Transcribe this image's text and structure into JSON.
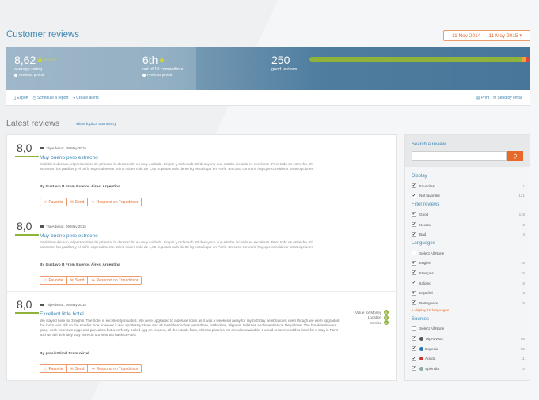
{
  "page_title": "Customer reviews",
  "date_range": "11 Nov 2014 — 11 May 2015",
  "stats": {
    "rating": {
      "value": "8,62",
      "delta": "+ 1.5%",
      "label": "average rating",
      "sub": "Previous period"
    },
    "rank": {
      "value": "6th",
      "label": "out of 10 competitors",
      "sub": "Previous period"
    },
    "good": {
      "value": "250",
      "label": "good reviews"
    }
  },
  "colors": {
    "accent": "#3f87b3",
    "orange": "#e86a2b",
    "green": "#8fb23a",
    "stats_bg": "#47769a"
  },
  "toolbar": {
    "export": "Export",
    "schedule": "Schedule a report",
    "alerts": "Create alerts",
    "print": "Print",
    "email": "Send by email"
  },
  "latest": {
    "title": "Latest reviews",
    "view_topics": "view topics summary"
  },
  "actions": {
    "favorite": "Favorite",
    "send": "Send",
    "respond": "Respond on Tripadvisor"
  },
  "reviews": [
    {
      "score": "8,0",
      "meta": "TripAdvisor, 09 May 2015",
      "title": "Muy bueno pero estrecho",
      "text": "Está bien ubicado, el personal es de primera, la decoración es muy cuidada. Limpio y ordenado. El desayuno que estaba incluido es excelente. Pero todo es estrecho. El ascensor, los pasillos y el baño especialmente. Si no mides más de 1,80 m pesas más de 80 kg es tu lugar en París. En caso contrario hay que considerar otras opciones",
      "author": "By Gustavo B From Buenos Aires, Argentina"
    },
    {
      "score": "8,0",
      "meta": "TripAdvisor, 09 May 2015",
      "title": "Muy bueno pero estrecho",
      "text": "Está bien ubicado, el personal es de primera, la decoración es muy cuidada. Limpio y ordenado. El desayuno que estaba incluido es excelente. Pero todo es estrecho. El ascensor, los pasillos y el baño especialmente. Si no mides más de 1,80 m pesas más de 80 kg es tu lugar en París. En caso contrario hay que considerar otras opciones",
      "author": "By Gustavo B From Buenos Aires, Argentina"
    },
    {
      "score": "8,0",
      "meta": "TripAdvisor, 06 May 2015",
      "title": "Excellent little hotel",
      "text": "We stayed here for 3 nights. The hotel is excellently situated. We were upgraded to a deluxe room as it was a weekend away for my birthday celebrations, even though we were upgraded the room was still on the smaller side however it was spotlessly clean and all the little touches were there, bathrobes, slippers, toiletries and sweeties on the pillows! The breakfasts were good, cook your own eggs and pancakes but a perfectly boiled egg on request, all the usuals from, cheese pastries etc are also available. I would recommend this hotel for a stay in Paris and we will definitely stay here on our next trip back to Paris",
      "author": "By gracieWirral From wirral",
      "subscores": [
        {
          "label": "Value for Money",
          "value": "5"
        },
        {
          "label": "Location",
          "value": "5"
        },
        {
          "label": "Service",
          "value": "5"
        }
      ]
    }
  ],
  "sidebar": {
    "search_label": "Search a review",
    "display": {
      "title": "Display",
      "items": [
        {
          "label": "Favorites",
          "count": "1",
          "checked": true
        },
        {
          "label": "Not favorites",
          "count": "121",
          "checked": true
        }
      ]
    },
    "filter": {
      "title": "Filter reviews",
      "items": [
        {
          "label": "Good",
          "count": "118",
          "checked": true
        },
        {
          "label": "Neutral",
          "count": "0",
          "checked": true
        },
        {
          "label": "Bad",
          "count": "4",
          "checked": true
        }
      ]
    },
    "languages": {
      "title": "Languages",
      "items": [
        {
          "label": "Select All/None",
          "count": "",
          "checked": false
        },
        {
          "label": "English",
          "count": "79",
          "checked": true
        },
        {
          "label": "Français",
          "count": "16",
          "checked": true
        },
        {
          "label": "Italiano",
          "count": "6",
          "checked": true
        },
        {
          "label": "Español",
          "count": "8",
          "checked": true
        },
        {
          "label": "Portuguese",
          "count": "5",
          "checked": true
        }
      ],
      "more": "+ display 16 languages"
    },
    "sources": {
      "title": "Sources",
      "items": [
        {
          "label": "Select All/None",
          "count": "",
          "checked": false
        },
        {
          "label": "TripAdvisor",
          "count": "85",
          "checked": true
        },
        {
          "label": "Expedia",
          "count": "25",
          "checked": true
        },
        {
          "label": "Agoda",
          "count": "11",
          "checked": true
        },
        {
          "label": "Splendia",
          "count": "0",
          "checked": true
        }
      ]
    }
  }
}
